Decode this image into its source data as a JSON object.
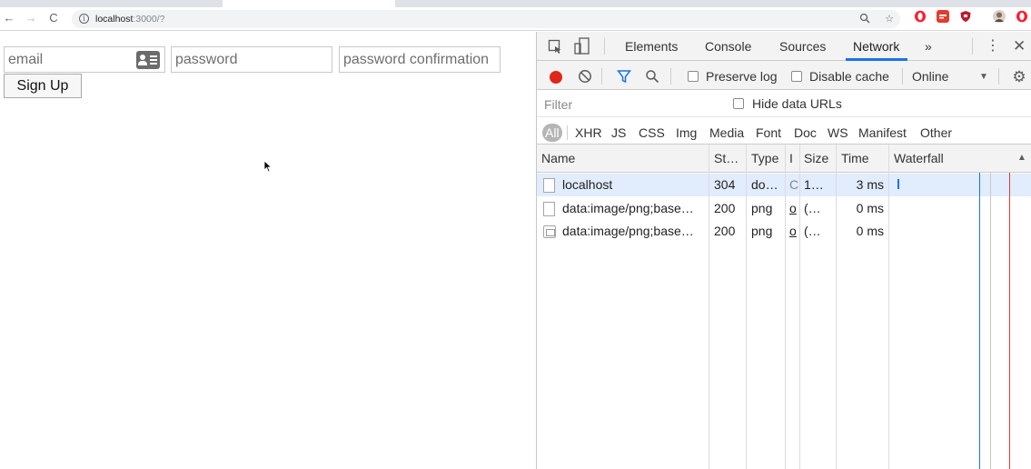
{
  "browser": {
    "url_host": "localhost",
    "url_rest": ":3000/?"
  },
  "form": {
    "email_placeholder": "email",
    "password_placeholder": "password",
    "password_confirmation_placeholder": "password confirmation",
    "signup_label": "Sign Up"
  },
  "devtools": {
    "tabs": [
      "Elements",
      "Console",
      "Sources",
      "Network",
      "»"
    ],
    "active_tab": "Network",
    "toolbar": {
      "preserve_log": "Preserve log",
      "disable_cache": "Disable cache",
      "throttling": "Online"
    },
    "filter_placeholder": "Filter",
    "hide_data_urls": "Hide data URLs",
    "types": [
      "All",
      "XHR",
      "JS",
      "CSS",
      "Img",
      "Media",
      "Font",
      "Doc",
      "WS",
      "Manifest",
      "Other"
    ],
    "columns": [
      "Name",
      "St…",
      "Type",
      "I",
      "Size",
      "Time",
      "Waterfall"
    ],
    "rows": [
      {
        "name": "localhost",
        "status": "304",
        "type": "do…",
        "initiator": "C",
        "size": "1…",
        "time": "3 ms"
      },
      {
        "name": "data:image/png;base…",
        "status": "200",
        "type": "png",
        "initiator": "o",
        "size": "(…",
        "time": "0 ms"
      },
      {
        "name": "data:image/png;base…",
        "status": "200",
        "type": "png",
        "initiator": "o",
        "size": "(…",
        "time": "0 ms"
      }
    ]
  },
  "colors": {
    "record": "#e0261b",
    "accent": "#1a73e8",
    "selected_row": "#e1ecfd",
    "load_line": "#e53935"
  }
}
